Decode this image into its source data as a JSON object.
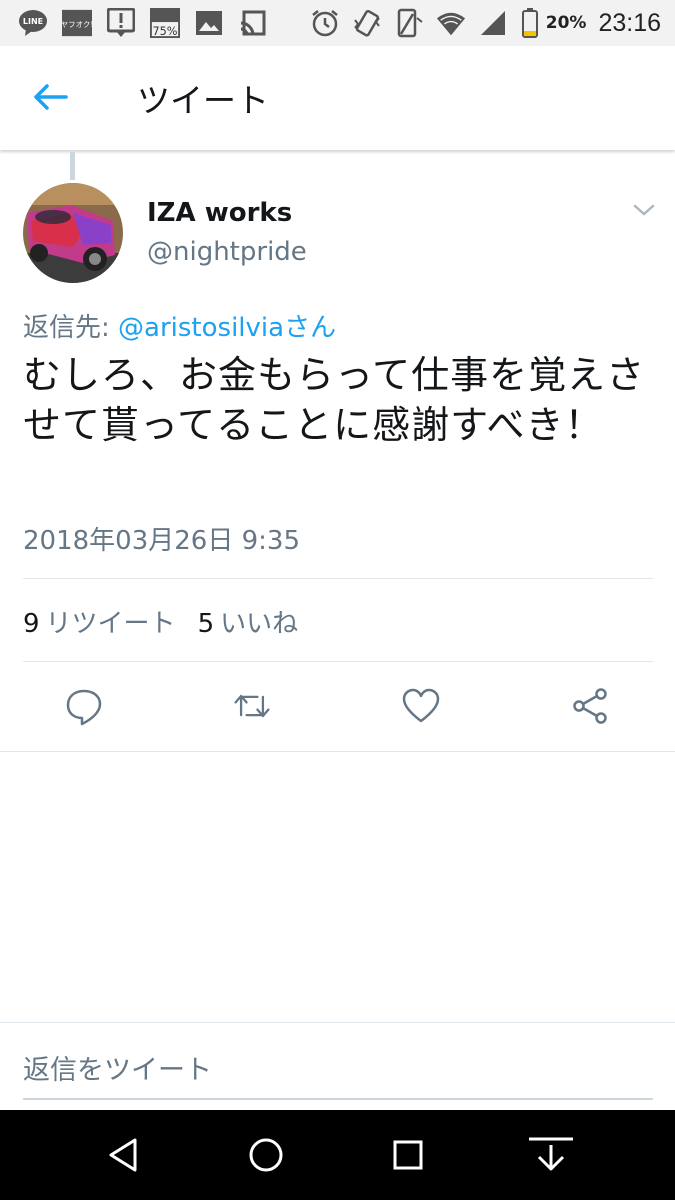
{
  "status_bar": {
    "time": "23:16",
    "battery_percent": "20%",
    "battery_level": 0.2,
    "icons": [
      "line-app-icon",
      "yafuoku-app-icon",
      "alert-icon",
      "storage-icon",
      "image-icon",
      "cast-icon",
      "alarm-icon",
      "vibrate-icon",
      "rotate-icon",
      "wifi-icon",
      "signal-icon",
      "battery-icon"
    ],
    "badge_line": "LINE",
    "badge_yahoo": "ヤフオク!",
    "badge_storage": "75%"
  },
  "header": {
    "title": "ツイート",
    "back_icon": "arrow-left-icon",
    "accent": "#1da1f2"
  },
  "tweet": {
    "display_name": "IZA works",
    "handle": "@nightpride",
    "reply_prefix": "返信先: ",
    "reply_to": "@aristosilvia",
    "reply_suffix": "さん",
    "text": "むしろ、お金もらって仕事を覚えさせて貰ってることに感謝すべき！",
    "timestamp": "2018年03月26日 9:35",
    "retweet_count": "9",
    "retweet_label": "リツイート",
    "like_count": "5",
    "like_label": "いいね"
  },
  "actions": [
    "reply-icon",
    "retweet-icon",
    "like-icon",
    "share-icon"
  ],
  "reply_box": {
    "placeholder": "返信をツイート"
  },
  "nav_bar": {
    "buttons": [
      "back-triangle-icon",
      "home-circle-icon",
      "recents-square-icon",
      "hide-keyboard-icon"
    ]
  }
}
